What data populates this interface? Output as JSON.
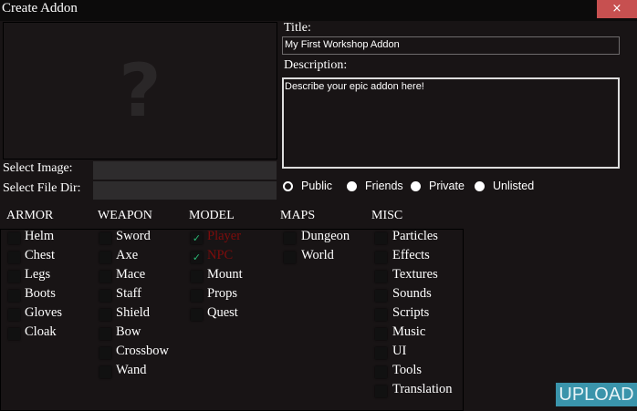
{
  "window": {
    "title": "Create Addon",
    "close_icon": "×"
  },
  "image_placeholder": "?",
  "select_image": {
    "label": "Select Image:",
    "value": ""
  },
  "select_dir": {
    "label": "Select File Dir:",
    "value": ""
  },
  "title_field": {
    "label": "Title:",
    "value": "My First Workshop Addon"
  },
  "description": {
    "label": "Description:",
    "value": "Describe your epic addon here!"
  },
  "visibility": {
    "options": [
      "Public",
      "Friends",
      "Private",
      "Unlisted"
    ],
    "selected": "Public"
  },
  "categories": [
    {
      "name": "ARMOR",
      "items": [
        {
          "label": "Helm",
          "checked": false
        },
        {
          "label": "Chest",
          "checked": false
        },
        {
          "label": "Legs",
          "checked": false
        },
        {
          "label": "Boots",
          "checked": false
        },
        {
          "label": "Gloves",
          "checked": false
        },
        {
          "label": "Cloak",
          "checked": false
        }
      ]
    },
    {
      "name": "WEAPON",
      "items": [
        {
          "label": "Sword",
          "checked": false
        },
        {
          "label": "Axe",
          "checked": false
        },
        {
          "label": "Mace",
          "checked": false
        },
        {
          "label": "Staff",
          "checked": false
        },
        {
          "label": "Shield",
          "checked": false
        },
        {
          "label": "Bow",
          "checked": false
        },
        {
          "label": "Crossbow",
          "checked": false
        },
        {
          "label": "Wand",
          "checked": false
        }
      ]
    },
    {
      "name": "MODEL",
      "items": [
        {
          "label": "Player",
          "checked": true
        },
        {
          "label": "NPC",
          "checked": true
        },
        {
          "label": "Mount",
          "checked": false
        },
        {
          "label": "Props",
          "checked": false
        },
        {
          "label": "Quest",
          "checked": false
        }
      ]
    },
    {
      "name": "MAPS",
      "items": [
        {
          "label": "Dungeon",
          "checked": false
        },
        {
          "label": "World",
          "checked": false
        }
      ]
    },
    {
      "name": "MISC",
      "items": [
        {
          "label": "Particles",
          "checked": false
        },
        {
          "label": "Effects",
          "checked": false
        },
        {
          "label": "Textures",
          "checked": false
        },
        {
          "label": "Sounds",
          "checked": false
        },
        {
          "label": "Scripts",
          "checked": false
        },
        {
          "label": "Music",
          "checked": false
        },
        {
          "label": "UI",
          "checked": false
        },
        {
          "label": "Tools",
          "checked": false
        },
        {
          "label": "Translation",
          "checked": false
        }
      ]
    }
  ],
  "upload_label": "UPLOAD",
  "colors": {
    "accent": "#3a94ab",
    "close": "#c75050",
    "check": "#2bb673",
    "checked_label": "#7d0c0c"
  }
}
